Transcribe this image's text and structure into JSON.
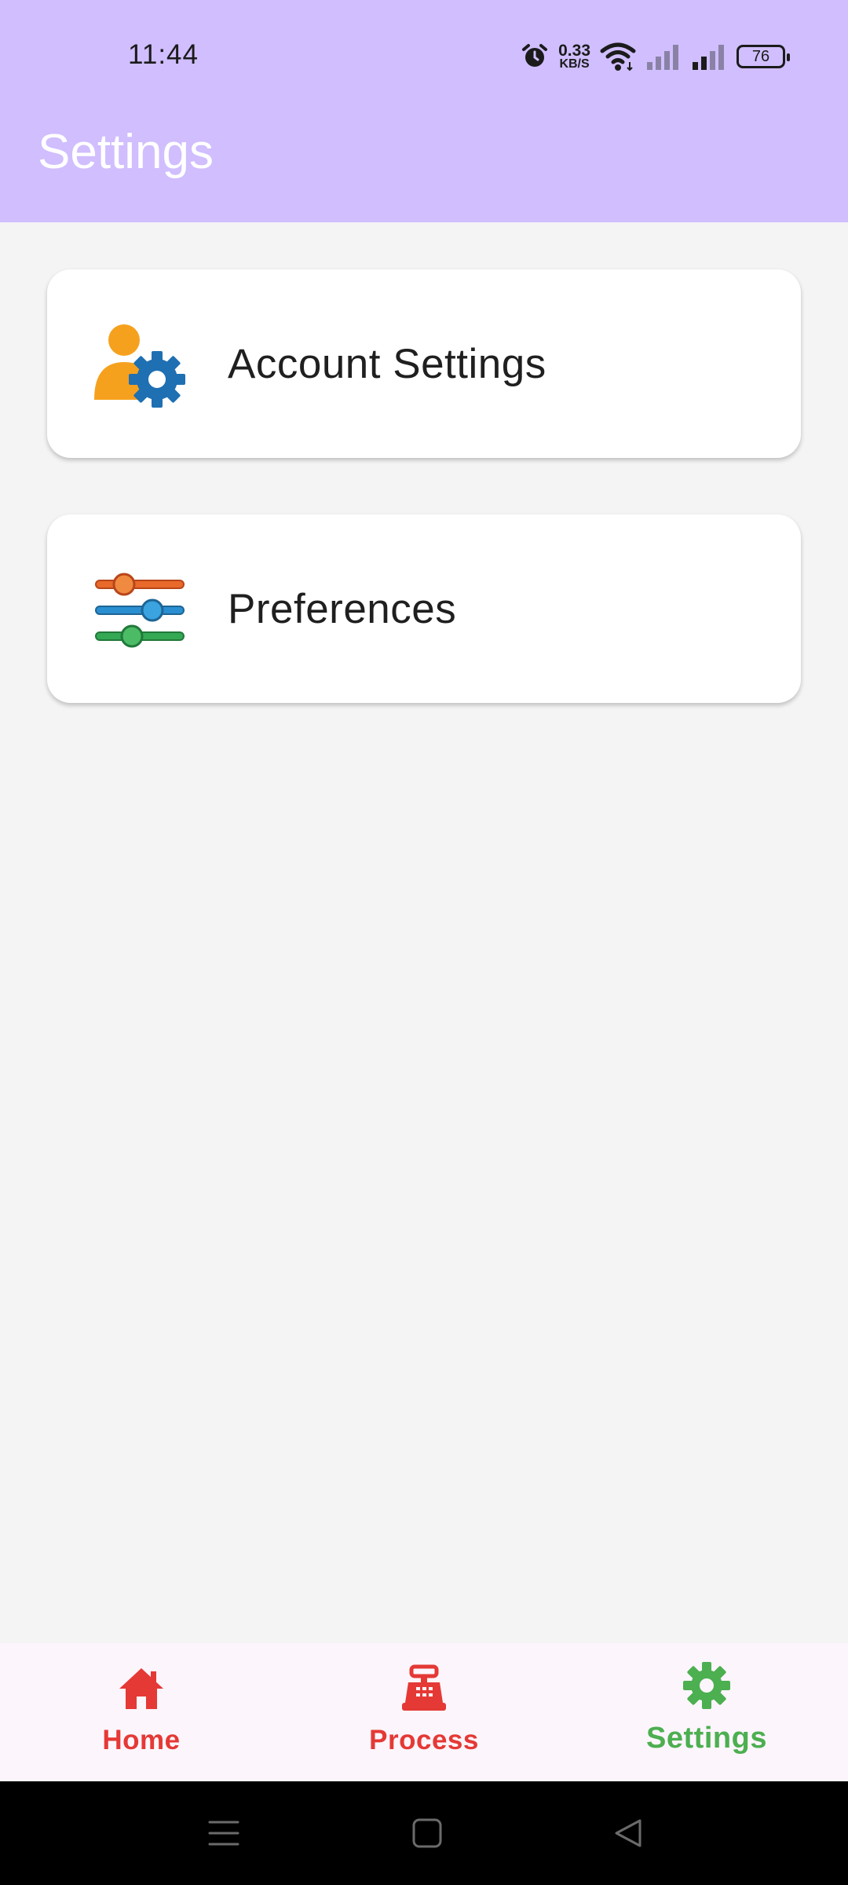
{
  "status_bar": {
    "time": "11:44",
    "net_speed_value": "0.33",
    "net_speed_unit": "KB/S",
    "battery": "76"
  },
  "header": {
    "title": "Settings",
    "background_color": "#d0befe"
  },
  "cards": [
    {
      "label": "Account Settings",
      "icon": "user-gear-icon"
    },
    {
      "label": "Preferences",
      "icon": "sliders-icon"
    }
  ],
  "bottom_nav": {
    "items": [
      {
        "label": "Home",
        "icon": "home-icon",
        "color": "#e53935",
        "active": false
      },
      {
        "label": "Process",
        "icon": "cash-register-icon",
        "color": "#e53935",
        "active": false
      },
      {
        "label": "Settings",
        "icon": "gear-icon",
        "color": "#4caf50",
        "active": true
      }
    ]
  },
  "system_nav": {
    "buttons": [
      "menu-icon",
      "home-square-icon",
      "back-triangle-icon"
    ]
  }
}
